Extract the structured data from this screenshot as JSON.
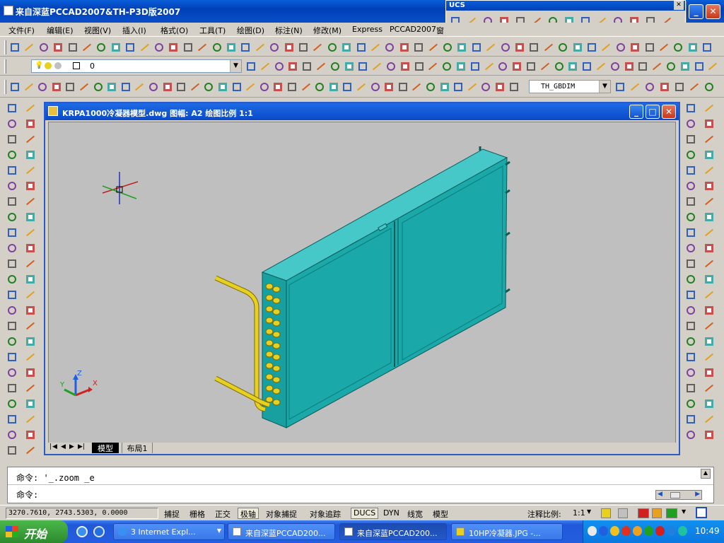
{
  "window": {
    "title": "来自深蓝PCCAD2007&TH-P3D版2007",
    "minimize": "_",
    "maximize": "□",
    "close": "✕"
  },
  "menu": [
    "文件(F)",
    "编辑(E)",
    "视图(V)",
    "插入(I)",
    "格式(O)",
    "工具(T)",
    "绘图(D)",
    "标注(N)",
    "修改(M)",
    "Express",
    "PCCAD2007",
    "窗"
  ],
  "ucs_toolbar": {
    "title": "UCS",
    "close": "✕"
  },
  "layer": {
    "current": "0"
  },
  "dimstyle": {
    "current": "TH_GBDIM"
  },
  "drawing_window": {
    "title": "KRPA1000冷凝器模型.dwg 图幅: A2 绘图比例 1:1",
    "tabs": [
      "模型",
      "布局1"
    ],
    "nav": [
      "|◀",
      "◀",
      "▶",
      "▶|"
    ]
  },
  "ucs_icon": {
    "x": "X",
    "y": "Y",
    "z": "Z"
  },
  "command": {
    "line1": "命令: '_.zoom _e",
    "line2": "命令:"
  },
  "status": {
    "coords": "3270.7610, 2743.5303, 0.0000",
    "toggles": [
      "捕捉",
      "栅格",
      "正交",
      "极轴",
      "对象捕捉",
      "对象追踪",
      "DUCS",
      "DYN",
      "线宽",
      "模型"
    ],
    "annotation_scale_label": "注释比例:",
    "annotation_scale": "1:1"
  },
  "taskbar": {
    "start": "开始",
    "tasks": [
      "3 Internet Expl...",
      "来自深蓝PCCAD200...",
      "来自深蓝PCCAD200...",
      "10HP冷凝器.JPG -..."
    ],
    "clock": "10:49"
  },
  "colors": {
    "model_face": "#1aa8a8",
    "model_top": "#46c8c8",
    "model_edge": "#0a5a5a",
    "pipe": "#e8d020",
    "viewport_bg": "#bfbfbf"
  }
}
